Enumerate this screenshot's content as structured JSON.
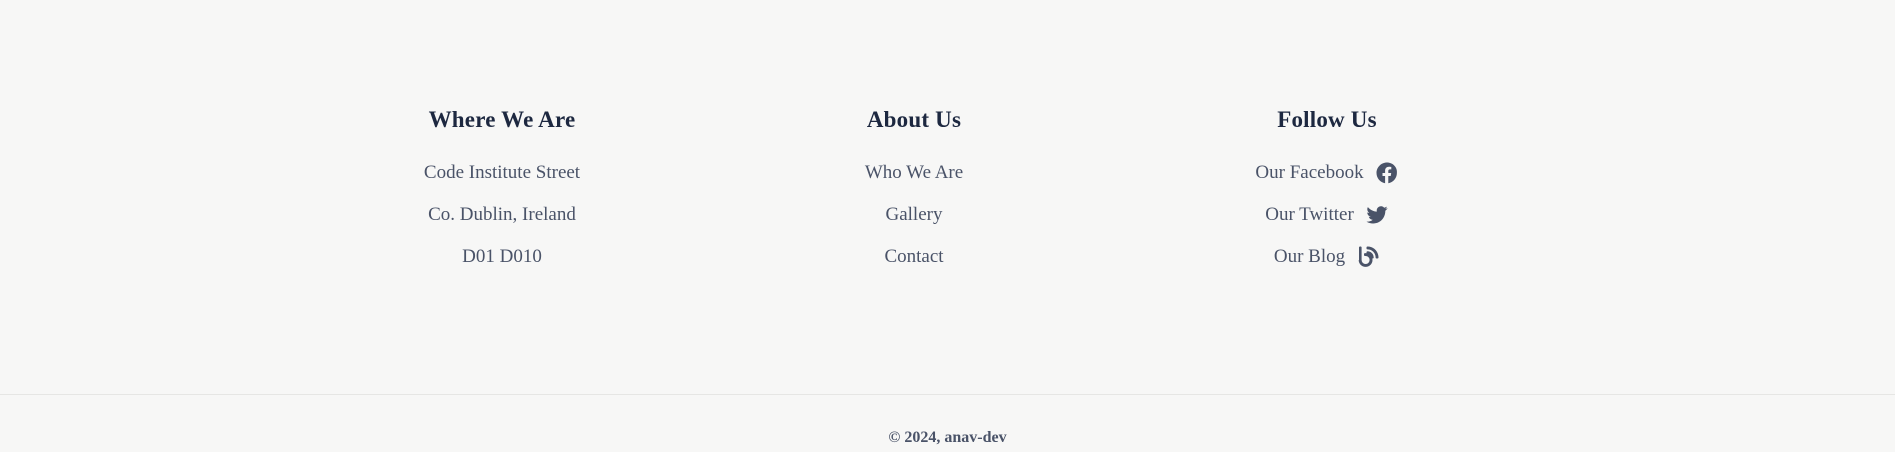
{
  "where": {
    "heading": "Where We Are",
    "lines": [
      "Code Institute Street",
      "Co. Dublin, Ireland",
      "D01 D010"
    ]
  },
  "about": {
    "heading": "About Us",
    "links": [
      "Who We Are",
      "Gallery",
      "Contact"
    ]
  },
  "follow": {
    "heading": "Follow Us",
    "links": [
      {
        "label": "Our Facebook",
        "icon": "facebook-icon"
      },
      {
        "label": "Our Twitter",
        "icon": "twitter-icon"
      },
      {
        "label": "Our Blog",
        "icon": "blog-icon"
      }
    ]
  },
  "copyright": "© 2024, anav-dev",
  "colors": {
    "background": "#f7f7f6",
    "heading": "#1d2840",
    "text": "#4a5368"
  }
}
